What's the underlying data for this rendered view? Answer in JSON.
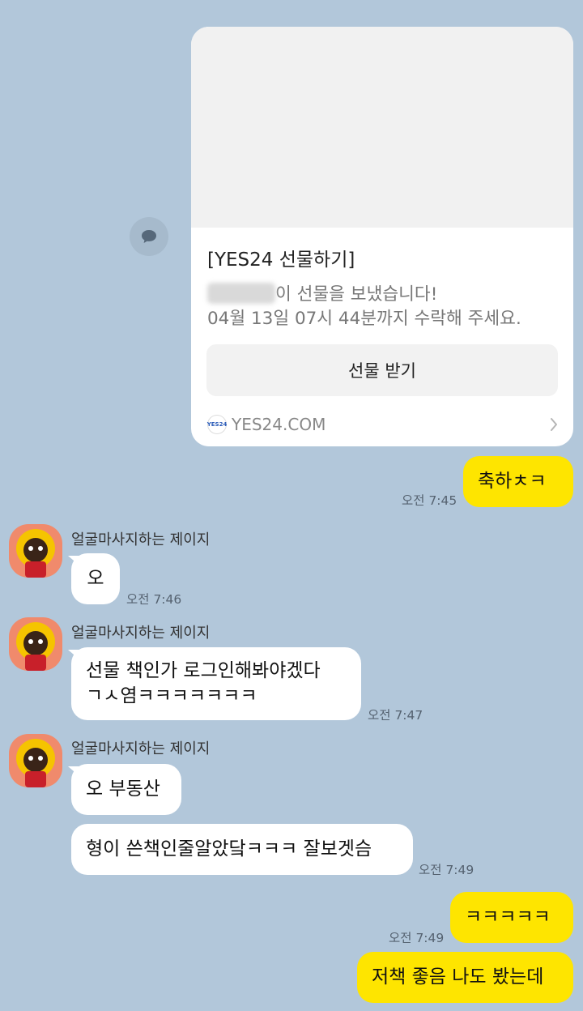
{
  "gift_card": {
    "title": "[YES24 선물하기]",
    "message_line1": "이 선물을 보냈습니다!",
    "message_line2": "04월 13일 07시 44분까지 수락해 주세요.",
    "button_label": "선물 받기",
    "logo_text": "YES24",
    "domain": "YES24.COM"
  },
  "messages": [
    {
      "from": "me",
      "text": "축하ㅊㅋ",
      "time": "오전 7:45"
    },
    {
      "from": "other",
      "sender": "얼굴마사지하는 제이지",
      "text": "오",
      "time": "오전 7:46"
    },
    {
      "from": "other",
      "sender": "얼굴마사지하는 제이지",
      "line1": "선물 책인가 로그인해봐야겠다",
      "line2": "ㄱㅅ염ㅋㅋㅋㅋㅋㅋㅋ",
      "time": "오전 7:47"
    },
    {
      "from": "other",
      "sender": "얼굴마사지하는 제이지",
      "text": "오 부동산"
    },
    {
      "from": "other",
      "text": "형이 쓴책인줄알았닼ㅋㅋㅋ 잘보겟슴",
      "time": "오전 7:49"
    },
    {
      "from": "me",
      "text": "ㅋㅋㅋㅋㅋ",
      "time": "오전 7:49"
    },
    {
      "from": "me",
      "text": "저책 좋음 나도 봤는데"
    }
  ],
  "colors": {
    "background": "#b2c7da",
    "my_bubble": "#fee500",
    "other_bubble": "#ffffff",
    "avatar_bg": "#f08a6c"
  },
  "icons": [
    "share-icon",
    "chevron-right-icon",
    "yes24-logo",
    "profile-avatar"
  ]
}
